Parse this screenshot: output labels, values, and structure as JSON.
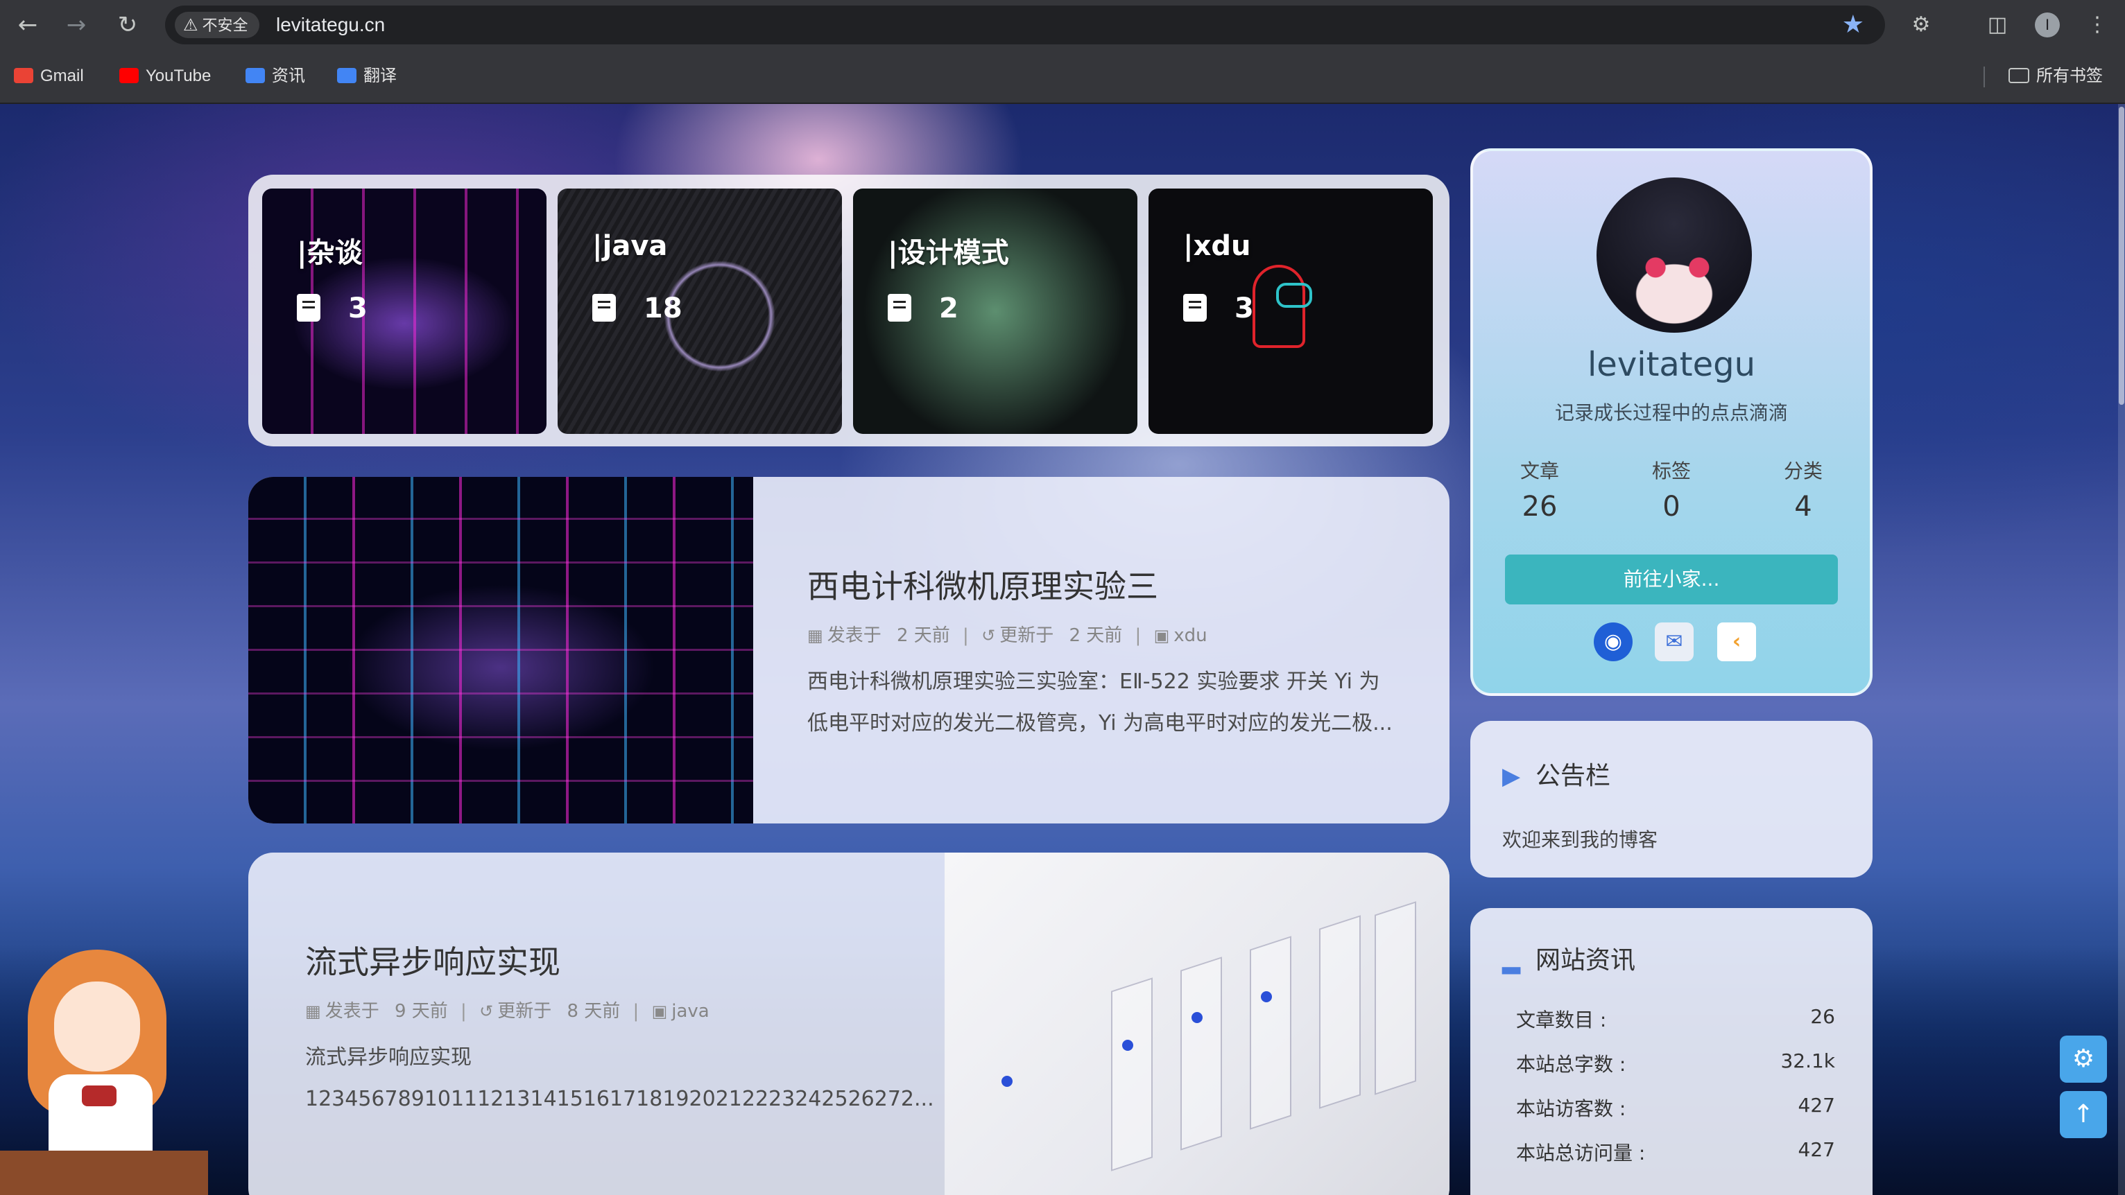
{
  "browser": {
    "security_label": "不安全",
    "url": "levitategu.cn",
    "profile_initial": "I",
    "bookmarks": [
      {
        "label": "Gmail",
        "icon": "gmail-icon",
        "color": "#ea4335"
      },
      {
        "label": "YouTube",
        "icon": "youtube-icon",
        "color": "#ff0000"
      },
      {
        "label": "资讯",
        "icon": "news-icon",
        "color": "#4285f4"
      },
      {
        "label": "翻译",
        "icon": "translate-icon",
        "color": "#4285f4"
      }
    ],
    "all_bookmarks": "所有书签"
  },
  "categories": [
    {
      "name": "|杂谈",
      "count": "3"
    },
    {
      "name": "|java",
      "count": "18"
    },
    {
      "name": "|设计模式",
      "count": "2"
    },
    {
      "name": "|xdu",
      "count": "3"
    }
  ],
  "posts": [
    {
      "title": "西电计科微机原理实验三",
      "published_label": "发表于",
      "published": "2 天前",
      "updated_label": "更新于",
      "updated": "2 天前",
      "category": "xdu",
      "excerpt_line1": "西电计科微机原理实验三实验室：EⅡ-522 实验要求 开关 Yi 为",
      "excerpt_line2": "低电平时对应的发光二极管亮，Yi 为高电平时对应的发光二极..."
    },
    {
      "title": "流式异步响应实现",
      "published_label": "发表于",
      "published": "9 天前",
      "updated_label": "更新于",
      "updated": "8 天前",
      "category": "java",
      "excerpt_line1": "流式异步响应实现",
      "excerpt_line2": "1234567891011121314151617181920212223242526272..."
    }
  ],
  "profile": {
    "name": "levitategu",
    "description": "记录成长过程中的点点滴滴",
    "stats": [
      {
        "label": "文章",
        "value": "26"
      },
      {
        "label": "标签",
        "value": "0"
      },
      {
        "label": "分类",
        "value": "4"
      }
    ],
    "button_label": "前往小家..."
  },
  "notice": {
    "title": "公告栏",
    "text": "欢迎来到我的博客"
  },
  "site_info": {
    "title": "网站资讯",
    "rows": [
      {
        "label": "文章数目 :",
        "value": "26"
      },
      {
        "label": "本站总字数 :",
        "value": "32.1k"
      },
      {
        "label": "本站访客数 :",
        "value": "427"
      },
      {
        "label": "本站总访问量 :",
        "value": "427"
      }
    ]
  }
}
